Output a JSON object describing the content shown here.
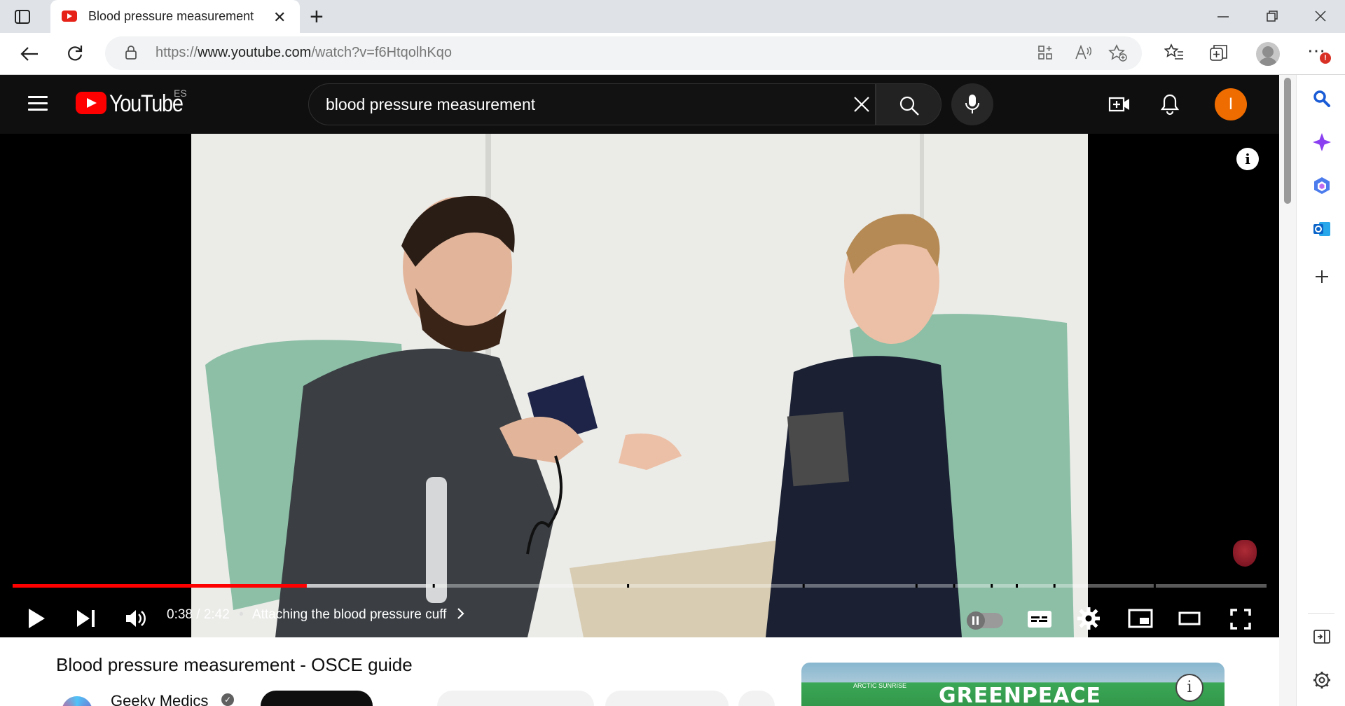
{
  "browser": {
    "tab_title": "Blood pressure measurement - OSCE guide",
    "url_prefix": "https://",
    "url_host": "www.youtube.com",
    "url_path": "/watch?v=f6HtqolhKqo",
    "new_tab_glyph": "+",
    "close_glyph": "✕"
  },
  "youtube": {
    "logo_text": "YouTube",
    "country_code": "ES",
    "search_query": "blood pressure measurement",
    "avatar_letter": "I"
  },
  "player": {
    "current_time": "0:38",
    "duration": "2:42",
    "time_separator": "/",
    "bullet": "•",
    "chapter_title": "Attaching the blood pressure cuff",
    "progress_played": 0.2346,
    "progress_buffered": 0.33,
    "chapter_marks": [
      0.335,
      0.49,
      0.63,
      0.72,
      0.75,
      0.78,
      0.8,
      0.83,
      0.91
    ],
    "accent_color": "#ff0000",
    "autoplay": "paused"
  },
  "video": {
    "title": "Blood pressure measurement - OSCE guide",
    "channel_name": "Geeky Medics",
    "verified_glyph": "✓"
  },
  "ad": {
    "brand": "GREENPEACE",
    "ship_name": "ARCTIC SUNRISE",
    "info_glyph": "i"
  }
}
